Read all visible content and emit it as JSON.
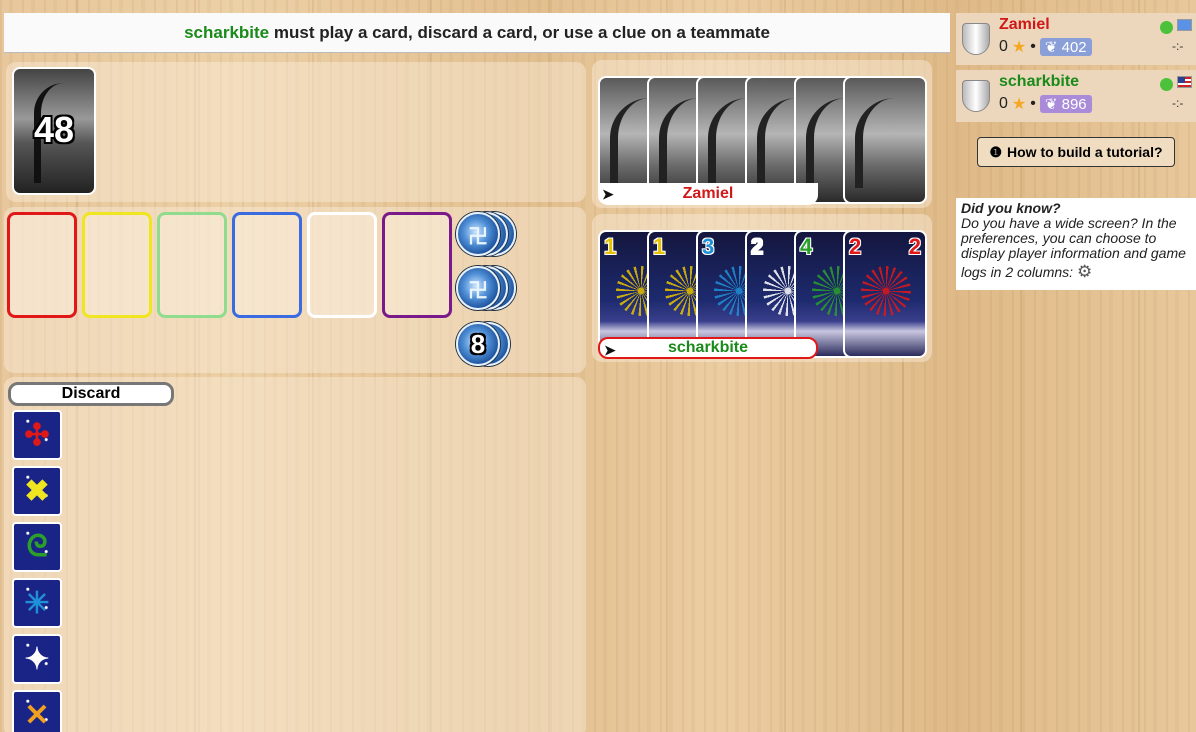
{
  "status": {
    "player": "scharkbite",
    "message": " must play a card, discard a card, or use a clue on a teammate"
  },
  "deck": {
    "count": "48"
  },
  "play_stacks": [
    {
      "suit": "red",
      "color": "#e01818"
    },
    {
      "suit": "yellow",
      "color": "#f0e620"
    },
    {
      "suit": "green",
      "color": "#8fdc8f"
    },
    {
      "suit": "blue",
      "color": "#3a6be0"
    },
    {
      "suit": "white",
      "color": "#ffffff"
    },
    {
      "suit": "purple",
      "color": "#7a1a8a"
    }
  ],
  "tokens": {
    "clue_tokens_shown": 2,
    "strikes": "8"
  },
  "hands": {
    "zamiel": {
      "name": "Zamiel",
      "name_color": "#d01818",
      "card_count": 6
    },
    "scharkbite": {
      "name": "scharkbite",
      "name_color": "#1a8a1a",
      "cards": [
        {
          "rank": "1",
          "color": "#e6c200"
        },
        {
          "rank": "1",
          "color": "#e6c200"
        },
        {
          "rank": "3",
          "color": "#1f8fd8"
        },
        {
          "rank": "2",
          "color": "#ffffff"
        },
        {
          "rank": "4",
          "color": "#2aa02a"
        },
        {
          "rank": "2",
          "color": "#e01818"
        }
      ]
    }
  },
  "discard": {
    "label": "Discard",
    "cards": [
      {
        "glyph": "✣",
        "color": "#e01818"
      },
      {
        "glyph": "✖",
        "color": "#f0e620"
      },
      {
        "glyph": "ᘓ",
        "color": "#2aa02a"
      },
      {
        "glyph": "✳",
        "color": "#1f8fd8"
      },
      {
        "glyph": "✦",
        "color": "#ffffff"
      },
      {
        "glyph": "✕",
        "color": "#f0a020"
      }
    ]
  },
  "players": [
    {
      "name": "Zamiel",
      "name_color": "#d01818",
      "stars": "0",
      "rating": "402",
      "time": "-:-",
      "flag": "un"
    },
    {
      "name": "scharkbite",
      "name_color": "#1a8a1a",
      "stars": "0",
      "rating": "896",
      "time": "-:-",
      "flag": "us"
    }
  ],
  "tutorial_button": {
    "label": "How to build a tutorial?"
  },
  "tip": {
    "title": "Did you know?",
    "body": "Do you have a wide screen? In the preferences, you can choose to display player information and game",
    "tail": "logs in 2 columns:"
  }
}
